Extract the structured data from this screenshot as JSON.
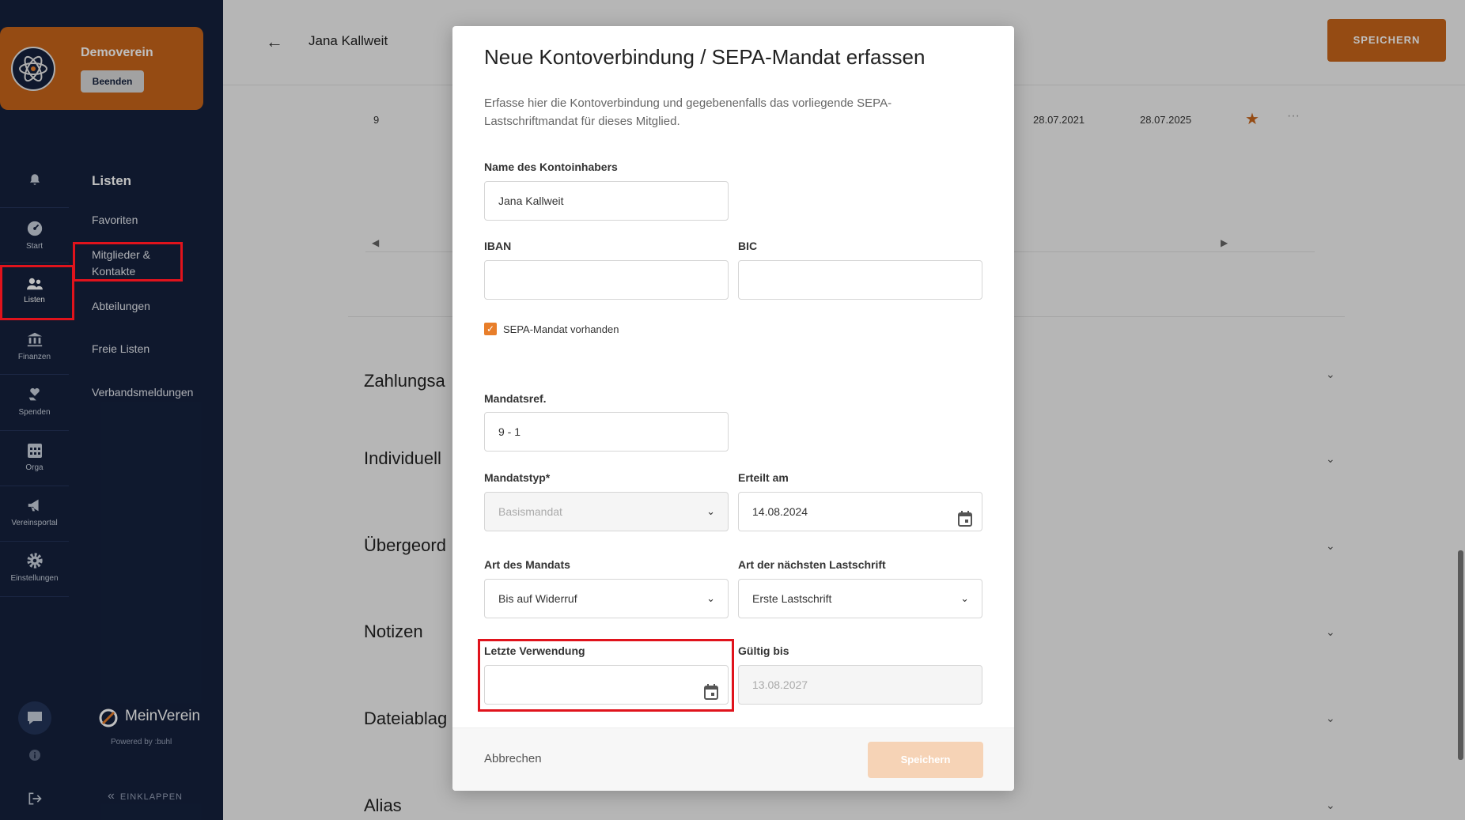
{
  "org": {
    "name": "Demoverein",
    "end_button": "Beenden"
  },
  "rail": {
    "items": [
      {
        "label": ""
      },
      {
        "label": "Start"
      },
      {
        "label": "Listen"
      },
      {
        "label": "Finanzen"
      },
      {
        "label": "Spenden"
      },
      {
        "label": "Orga"
      },
      {
        "label": "Vereinsportal"
      },
      {
        "label": "Einstellungen"
      }
    ]
  },
  "nav": {
    "heading": "Listen",
    "items": [
      {
        "label": "Favoriten"
      },
      {
        "label": "Mitglieder & Kontakte"
      },
      {
        "label": "Abteilungen"
      },
      {
        "label": "Freie Listen"
      },
      {
        "label": "Verbandsmeldungen"
      }
    ],
    "brand": "MeinVerein",
    "powered_by": "Powered by :buhl",
    "collapse": "EINKLAPPEN"
  },
  "page": {
    "member_name": "Jana Kallweit",
    "save_button": "SPEICHERN",
    "row": {
      "number": "9",
      "date1": "28.07.2021",
      "date2": "28.07.2025"
    },
    "sections": [
      "Zahlungsa",
      "Individuell",
      "Übergeord",
      "Notizen",
      "Dateiablag",
      "Alias"
    ]
  },
  "modal": {
    "title": "Neue Kontoverbindung / SEPA-Mandat erfassen",
    "description": "Erfasse hier die Kontoverbindung und gegebenenfalls das vorliegende SEPA-Lastschriftmandat für dieses Mitglied.",
    "account_holder": {
      "label": "Name des Kontoinhabers",
      "value": "Jana Kallweit"
    },
    "iban": {
      "label": "IBAN",
      "value": ""
    },
    "bic": {
      "label": "BIC",
      "value": ""
    },
    "sepa_checkbox": {
      "label": "SEPA-Mandat vorhanden",
      "checked": true
    },
    "mandate_ref": {
      "label": "Mandatsref.",
      "value": "9 - 1"
    },
    "mandate_type": {
      "label": "Mandatstyp*",
      "value": "Basismandat"
    },
    "issued_on": {
      "label": "Erteilt am",
      "value": "14.08.2024"
    },
    "mandate_kind": {
      "label": "Art des Mandats",
      "value": "Bis auf Widerruf"
    },
    "next_debit": {
      "label": "Art der nächsten Lastschrift",
      "value": "Erste Lastschrift"
    },
    "last_used": {
      "label": "Letzte Verwendung",
      "value": ""
    },
    "valid_until": {
      "label": "Gültig bis",
      "value": "13.08.2027"
    },
    "cancel": "Abbrechen",
    "save": "Speichern"
  },
  "colors": {
    "accent": "#c7651a",
    "sidebar": "#14213d",
    "highlight": "#e0131c"
  }
}
